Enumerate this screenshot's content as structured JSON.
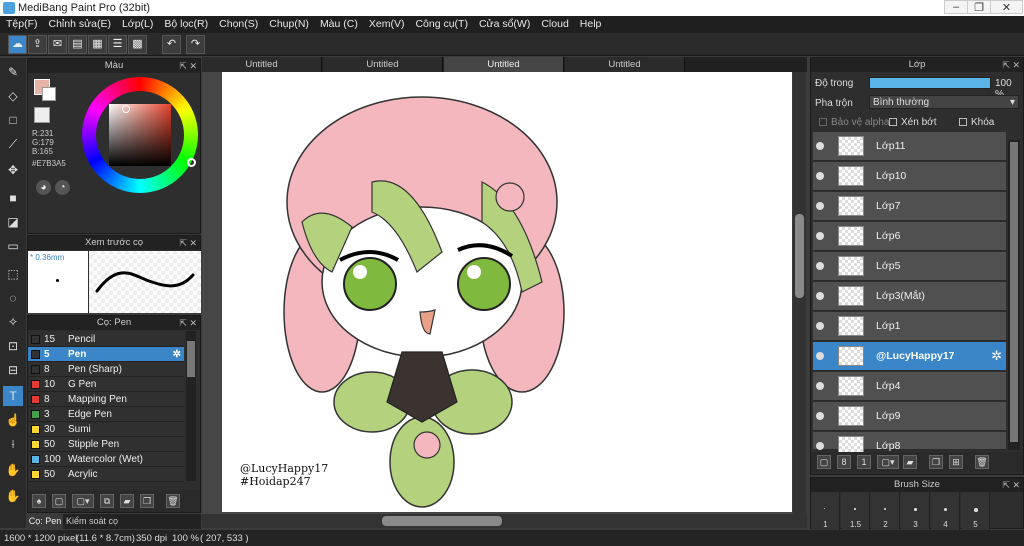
{
  "window": {
    "title": "MediBang Paint Pro (32bit)"
  },
  "menu": [
    "Tệp(F)",
    "Chỉnh sửa(E)",
    "Lớp(L)",
    "Bộ lọc(R)",
    "Chọn(S)",
    "Chụp(N)",
    "Màu (C)",
    "Xem(V)",
    "Công cụ(T)",
    "Cửa sổ(W)",
    "Cloud",
    "Help"
  ],
  "color_panel": {
    "title": "Màu",
    "r": "R:231",
    "g": "G:179",
    "b": "B:165",
    "hex": "#E7B3A5",
    "primary": "#E7B3A5"
  },
  "preview_panel": {
    "title": "Xem trước cọ",
    "size": "0.36mm"
  },
  "brush_panel": {
    "title": "Cọ: Pen",
    "brushes": [
      {
        "size": "15",
        "name": "Pencil",
        "color": "#333333"
      },
      {
        "size": "5",
        "name": "Pen",
        "color": "#333333"
      },
      {
        "size": "8",
        "name": "Pen (Sharp)",
        "color": "#333333"
      },
      {
        "size": "10",
        "name": "G Pen",
        "color": "#e53935"
      },
      {
        "size": "8",
        "name": "Mapping Pen",
        "color": "#e53935"
      },
      {
        "size": "3",
        "name": "Edge Pen",
        "color": "#43a047"
      },
      {
        "size": "30",
        "name": "Sumi",
        "color": "#fdd835"
      },
      {
        "size": "50",
        "name": "Stipple Pen",
        "color": "#fdd835"
      },
      {
        "size": "100",
        "name": "Watercolor (Wet)",
        "color": "#5ab4e6"
      },
      {
        "size": "50",
        "name": "Acrylic",
        "color": "#fdd835"
      }
    ],
    "selected": 1
  },
  "bottom_tabs": [
    "Cọ: Pen",
    "Kiểm soát cọ"
  ],
  "doc_tabs": [
    "Untitled",
    "Untitled",
    "Untitled",
    "Untitled"
  ],
  "canvas": {
    "signature1": "@LucyHappy17",
    "signature2": "#Hoidap247"
  },
  "layer_panel": {
    "title": "Lớp",
    "opacity_label": "Độ trong",
    "opacity": "100 %",
    "opacity_value": 100,
    "blend_label": "Pha trộn",
    "blend_value": "Bình thường",
    "protect_alpha": "Bảo vệ alpha",
    "clipping": "Xén bớt",
    "lock": "Khóa",
    "layers": [
      "Lớp11",
      "Lớp10",
      "Lớp7",
      "Lớp6",
      "Lớp5",
      "Lớp3(Mắt)",
      "Lớp1",
      "@LucyHappy17",
      "Lớp4",
      "Lớp9",
      "Lớp8"
    ],
    "selected": 7
  },
  "brush_size_panel": {
    "title": "Brush Size",
    "sizes": [
      "1",
      "1.5",
      "2",
      "3",
      "4",
      "5"
    ]
  },
  "status": {
    "doc_size": "1600 * 1200 pixel",
    "phys_size": "(11.6 * 8.7cm)",
    "dpi": "350 dpi",
    "zoom": "100 %",
    "coords": "( 207, 533 )"
  }
}
